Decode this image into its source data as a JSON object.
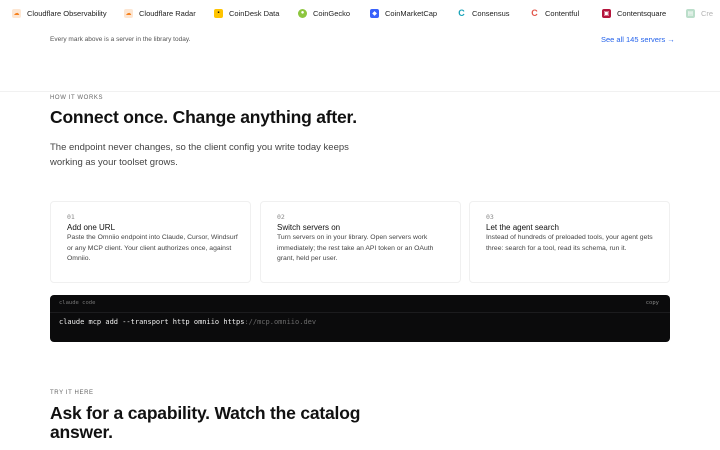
{
  "marquee": [
    {
      "name": "Cloudflare Observability",
      "icon": "cloudflare-icon",
      "color": "#f6821f"
    },
    {
      "name": "Cloudflare Radar",
      "icon": "cloudflare-icon",
      "color": "#f6821f"
    },
    {
      "name": "CoinDesk Data",
      "icon": "coindesk-icon",
      "color": "#ffc400"
    },
    {
      "name": "CoinGecko",
      "icon": "coingecko-icon",
      "color": "#8dc63f"
    },
    {
      "name": "CoinMarketCap",
      "icon": "coinmarketcap-icon",
      "color": "#3861fb"
    },
    {
      "name": "Consensus",
      "icon": "consensus-icon",
      "color": "#1aa3b8"
    },
    {
      "name": "Contentful",
      "icon": "contentful-icon",
      "color": "#e2574c"
    },
    {
      "name": "Contentsquare",
      "icon": "contentsquare-icon",
      "color": "#b4143c"
    },
    {
      "name": "Cre",
      "icon": "cre-icon",
      "color": "#3fa36b"
    }
  ],
  "caption": "Every mark above is a server in the library today.",
  "see_all": "See all 145 servers →",
  "how": {
    "eyebrow": "HOW IT WORKS",
    "title": "Connect once. Change anything after.",
    "lede": "The endpoint never changes, so the client config you write today keeps working as your toolset grows."
  },
  "steps": [
    {
      "num": "01",
      "title": "Add one URL",
      "body": "Paste the Omniio endpoint into Claude, Cursor, Windsurf or any MCP client. Your client authorizes once, against Omniio."
    },
    {
      "num": "02",
      "title": "Switch servers on",
      "body": "Turn servers on in your library. Open servers work immediately; the rest take an API token or an OAuth grant, held per user."
    },
    {
      "num": "03",
      "title": "Let the agent search",
      "body": "Instead of hundreds of preloaded tools, your agent gets three: search for a tool, read its schema, run it."
    }
  ],
  "code": {
    "label": "claude code",
    "copy": "copy",
    "command": "claude mcp add --transport http omniio https",
    "url_rest": "://mcp.omniio.dev"
  },
  "try": {
    "eyebrow": "TRY IT HERE",
    "title_line1": "Ask for a capability. Watch the catalog",
    "title_line2": "answer."
  }
}
